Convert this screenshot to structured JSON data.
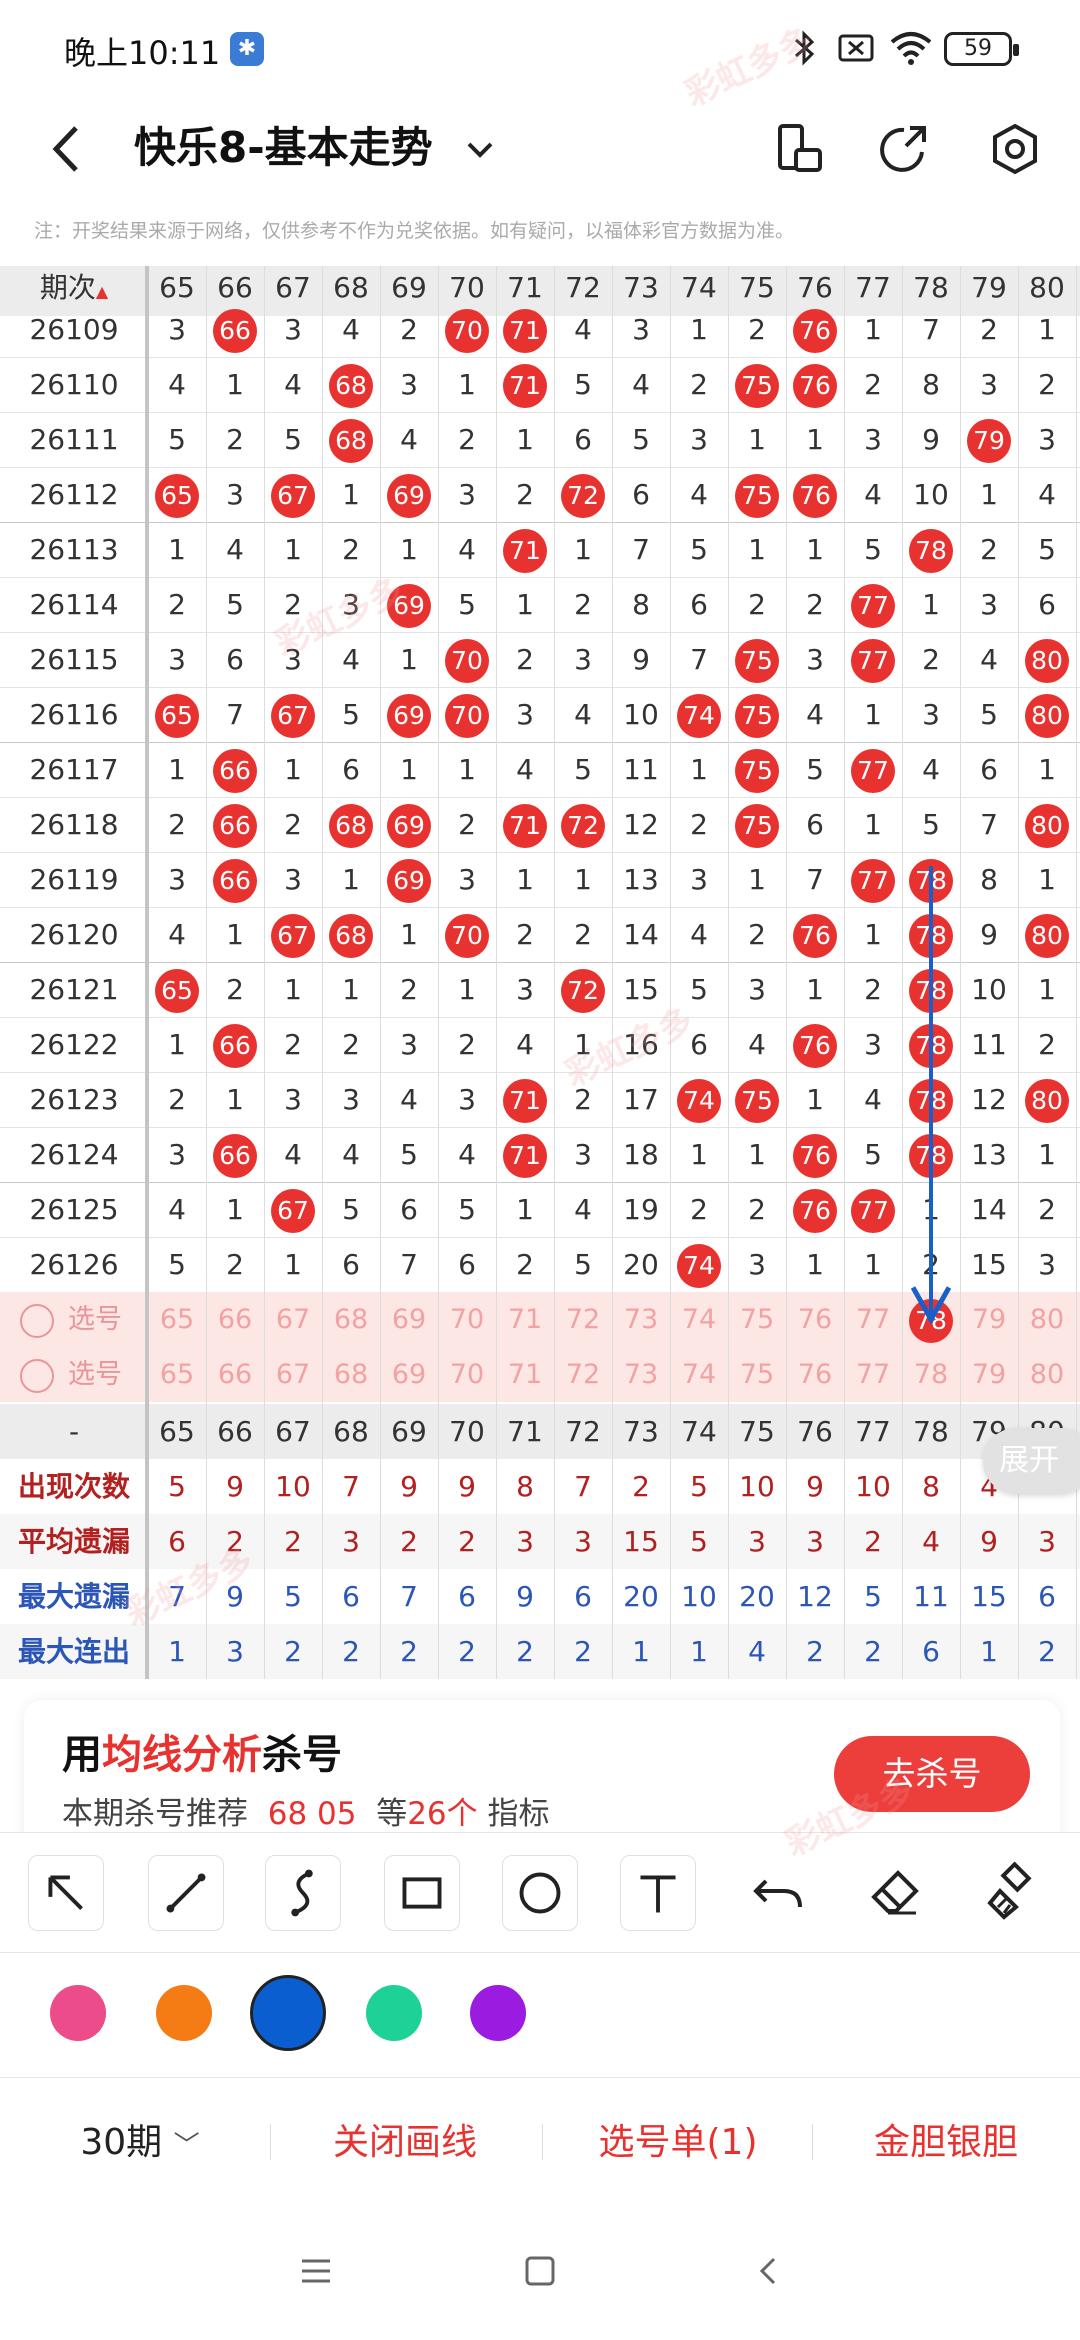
{
  "status_bar": {
    "time": "晚上10:11",
    "battery": "59"
  },
  "top_bar": {
    "title": "快乐8-基本走势"
  },
  "notice": "注：开奖结果来源于网络，仅供参考不作为兑奖依据。如有疑问，以福体彩官方数据为准。",
  "table": {
    "period_header": "期次",
    "columns": [
      "65",
      "66",
      "67",
      "68",
      "69",
      "70",
      "71",
      "72",
      "73",
      "74",
      "75",
      "76",
      "77",
      "78",
      "79",
      "80"
    ],
    "rows": [
      {
        "period": "26109",
        "cells": [
          "3",
          "66",
          "3",
          "4",
          "2",
          "70",
          "71",
          "4",
          "3",
          "1",
          "2",
          "76",
          "1",
          "7",
          "2",
          "1"
        ]
      },
      {
        "period": "26110",
        "cells": [
          "4",
          "1",
          "4",
          "68",
          "3",
          "1",
          "71",
          "5",
          "4",
          "2",
          "75",
          "76",
          "2",
          "8",
          "3",
          "2"
        ]
      },
      {
        "period": "26111",
        "cells": [
          "5",
          "2",
          "5",
          "68",
          "4",
          "2",
          "1",
          "6",
          "5",
          "3",
          "1",
          "1",
          "3",
          "9",
          "79",
          "3"
        ]
      },
      {
        "period": "26112",
        "cells": [
          "65",
          "3",
          "67",
          "1",
          "69",
          "3",
          "2",
          "72",
          "6",
          "4",
          "75",
          "76",
          "4",
          "10",
          "1",
          "4"
        ]
      },
      {
        "period": "26113",
        "cells": [
          "1",
          "4",
          "1",
          "2",
          "1",
          "4",
          "71",
          "1",
          "7",
          "5",
          "1",
          "1",
          "5",
          "78",
          "2",
          "5"
        ]
      },
      {
        "period": "26114",
        "cells": [
          "2",
          "5",
          "2",
          "3",
          "69",
          "5",
          "1",
          "2",
          "8",
          "6",
          "2",
          "2",
          "77",
          "1",
          "3",
          "6"
        ]
      },
      {
        "period": "26115",
        "cells": [
          "3",
          "6",
          "3",
          "4",
          "1",
          "70",
          "2",
          "3",
          "9",
          "7",
          "75",
          "3",
          "77",
          "2",
          "4",
          "80"
        ]
      },
      {
        "period": "26116",
        "cells": [
          "65",
          "7",
          "67",
          "5",
          "69",
          "70",
          "3",
          "4",
          "10",
          "74",
          "75",
          "4",
          "1",
          "3",
          "5",
          "80"
        ]
      },
      {
        "period": "26117",
        "cells": [
          "1",
          "66",
          "1",
          "6",
          "1",
          "1",
          "4",
          "5",
          "11",
          "1",
          "75",
          "5",
          "77",
          "4",
          "6",
          "1"
        ]
      },
      {
        "period": "26118",
        "cells": [
          "2",
          "66",
          "2",
          "68",
          "69",
          "2",
          "71",
          "72",
          "12",
          "2",
          "75",
          "6",
          "1",
          "5",
          "7",
          "80"
        ]
      },
      {
        "period": "26119",
        "cells": [
          "3",
          "66",
          "3",
          "1",
          "69",
          "3",
          "1",
          "1",
          "13",
          "3",
          "1",
          "7",
          "77",
          "78",
          "8",
          "1"
        ]
      },
      {
        "period": "26120",
        "cells": [
          "4",
          "1",
          "67",
          "68",
          "1",
          "70",
          "2",
          "2",
          "14",
          "4",
          "2",
          "76",
          "1",
          "78",
          "9",
          "80"
        ]
      },
      {
        "period": "26121",
        "cells": [
          "65",
          "2",
          "1",
          "1",
          "2",
          "1",
          "3",
          "72",
          "15",
          "5",
          "3",
          "1",
          "2",
          "78",
          "10",
          "1"
        ]
      },
      {
        "period": "26122",
        "cells": [
          "1",
          "66",
          "2",
          "2",
          "3",
          "2",
          "4",
          "1",
          "16",
          "6",
          "4",
          "76",
          "3",
          "78",
          "11",
          "2"
        ]
      },
      {
        "period": "26123",
        "cells": [
          "2",
          "1",
          "3",
          "3",
          "4",
          "3",
          "71",
          "2",
          "17",
          "74",
          "75",
          "1",
          "4",
          "78",
          "12",
          "80"
        ]
      },
      {
        "period": "26124",
        "cells": [
          "3",
          "66",
          "4",
          "4",
          "5",
          "4",
          "71",
          "3",
          "18",
          "1",
          "1",
          "76",
          "5",
          "78",
          "13",
          "1"
        ]
      },
      {
        "period": "26125",
        "cells": [
          "4",
          "1",
          "67",
          "5",
          "6",
          "5",
          "1",
          "4",
          "19",
          "2",
          "2",
          "76",
          "77",
          "1",
          "14",
          "2"
        ]
      },
      {
        "period": "26126",
        "cells": [
          "5",
          "2",
          "1",
          "6",
          "7",
          "6",
          "2",
          "5",
          "20",
          "74",
          "3",
          "1",
          "1",
          "2",
          "15",
          "3"
        ]
      }
    ],
    "pick_rows": [
      {
        "label": "选号",
        "cells": [
          "65",
          "66",
          "67",
          "68",
          "69",
          "70",
          "71",
          "72",
          "73",
          "74",
          "75",
          "76",
          "77",
          "78",
          "79",
          "80"
        ],
        "selected": "78"
      },
      {
        "label": "选号",
        "cells": [
          "65",
          "66",
          "67",
          "68",
          "69",
          "70",
          "71",
          "72",
          "73",
          "74",
          "75",
          "76",
          "77",
          "78",
          "79",
          "80"
        ],
        "selected": ""
      }
    ],
    "footer_header": {
      "label": "-",
      "cells": [
        "65",
        "66",
        "67",
        "68",
        "69",
        "70",
        "71",
        "72",
        "73",
        "74",
        "75",
        "76",
        "77",
        "78",
        "79",
        "80"
      ]
    },
    "stats": [
      {
        "label": "出现次数",
        "color": "#b32020",
        "cells": [
          "5",
          "9",
          "10",
          "7",
          "9",
          "9",
          "8",
          "7",
          "2",
          "5",
          "10",
          "9",
          "10",
          "8",
          "4",
          ""
        ]
      },
      {
        "label": "平均遗漏",
        "color": "#b32020",
        "cells": [
          "6",
          "2",
          "2",
          "3",
          "2",
          "2",
          "3",
          "3",
          "15",
          "5",
          "3",
          "3",
          "2",
          "4",
          "9",
          "3"
        ]
      },
      {
        "label": "最大遗漏",
        "color": "#2b56b8",
        "cells": [
          "7",
          "9",
          "5",
          "6",
          "7",
          "6",
          "9",
          "6",
          "20",
          "10",
          "20",
          "12",
          "5",
          "11",
          "15",
          "6"
        ]
      },
      {
        "label": "最大连出",
        "color": "#2b56b8",
        "cells": [
          "1",
          "3",
          "2",
          "2",
          "2",
          "2",
          "2",
          "2",
          "1",
          "1",
          "4",
          "2",
          "2",
          "6",
          "1",
          "2"
        ]
      }
    ],
    "expand_label": "展开"
  },
  "promo": {
    "title_prefix": "用",
    "title_highlight": "均线分析",
    "title_suffix": "杀号",
    "sub_prefix": "本期杀号推荐",
    "sub_numbers": "68 05",
    "sub_mid": "等",
    "sub_count": "26个",
    "sub_suffix": "指标",
    "button": "去杀号"
  },
  "tools": [
    "arrow-tool-icon",
    "line-tool-icon",
    "curve-tool-icon",
    "rectangle-tool-icon",
    "circle-tool-icon",
    "text-tool-icon",
    "undo-icon",
    "eraser-icon",
    "clear-icon"
  ],
  "colors": [
    "#ec4c8a",
    "#f57c14",
    "#0a5ecf",
    "#1ed196",
    "#9b1be0"
  ],
  "bottom_bar": {
    "period_select": "30期",
    "close_line": "关闭画线",
    "pick_list": "选号单(1)",
    "gold_silver": "金胆银胆"
  },
  "watermark": "彩虹多多"
}
